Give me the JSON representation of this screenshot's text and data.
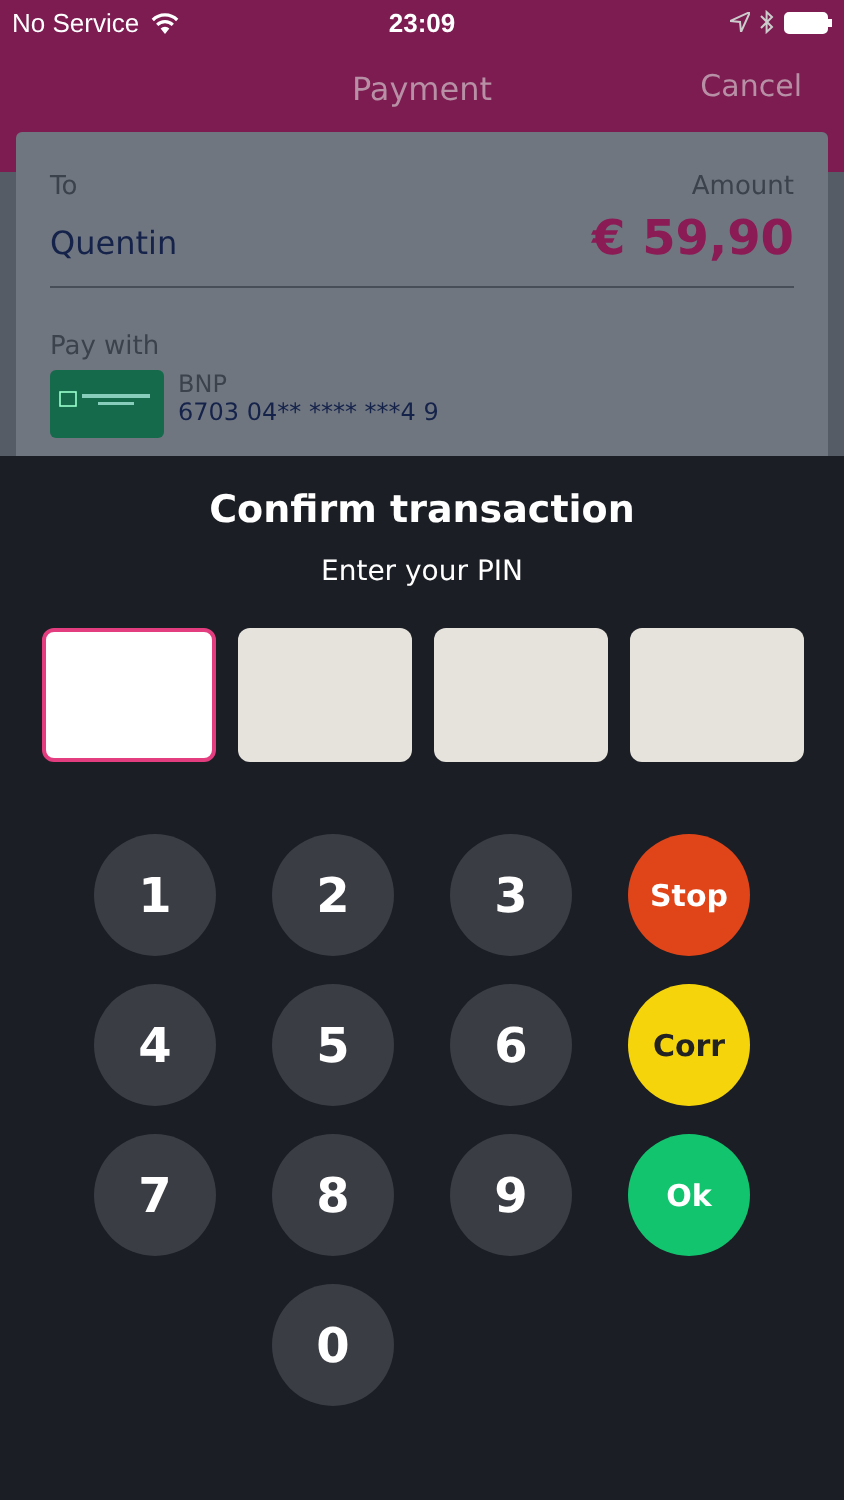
{
  "status_bar": {
    "carrier": "No Service",
    "time": "23:09"
  },
  "nav": {
    "title": "Payment",
    "action": "Cancel"
  },
  "payment": {
    "to_label": "To",
    "to_value": "Quentin",
    "amount_label": "Amount",
    "amount_value": "€ 59,90",
    "pay_with_label": "Pay with",
    "card": {
      "bank": "BNP",
      "number": "6703 04** **** ***4 9"
    }
  },
  "dialog": {
    "title": "Confirm transaction",
    "subtitle": "Enter your PIN",
    "pin_boxes": [
      {
        "selected": true
      },
      {
        "selected": false
      },
      {
        "selected": false
      },
      {
        "selected": false
      }
    ],
    "keys": [
      {
        "label": "1",
        "kind": "digit"
      },
      {
        "label": "2",
        "kind": "digit"
      },
      {
        "label": "3",
        "kind": "digit"
      },
      {
        "label": "Stop",
        "kind": "stop"
      },
      {
        "label": "4",
        "kind": "digit"
      },
      {
        "label": "5",
        "kind": "digit"
      },
      {
        "label": "6",
        "kind": "digit"
      },
      {
        "label": "Corr",
        "kind": "correct"
      },
      {
        "label": "7",
        "kind": "digit"
      },
      {
        "label": "8",
        "kind": "digit"
      },
      {
        "label": "9",
        "kind": "digit"
      },
      {
        "label": "Ok",
        "kind": "ok"
      },
      {
        "label": "0",
        "kind": "digit"
      }
    ]
  }
}
